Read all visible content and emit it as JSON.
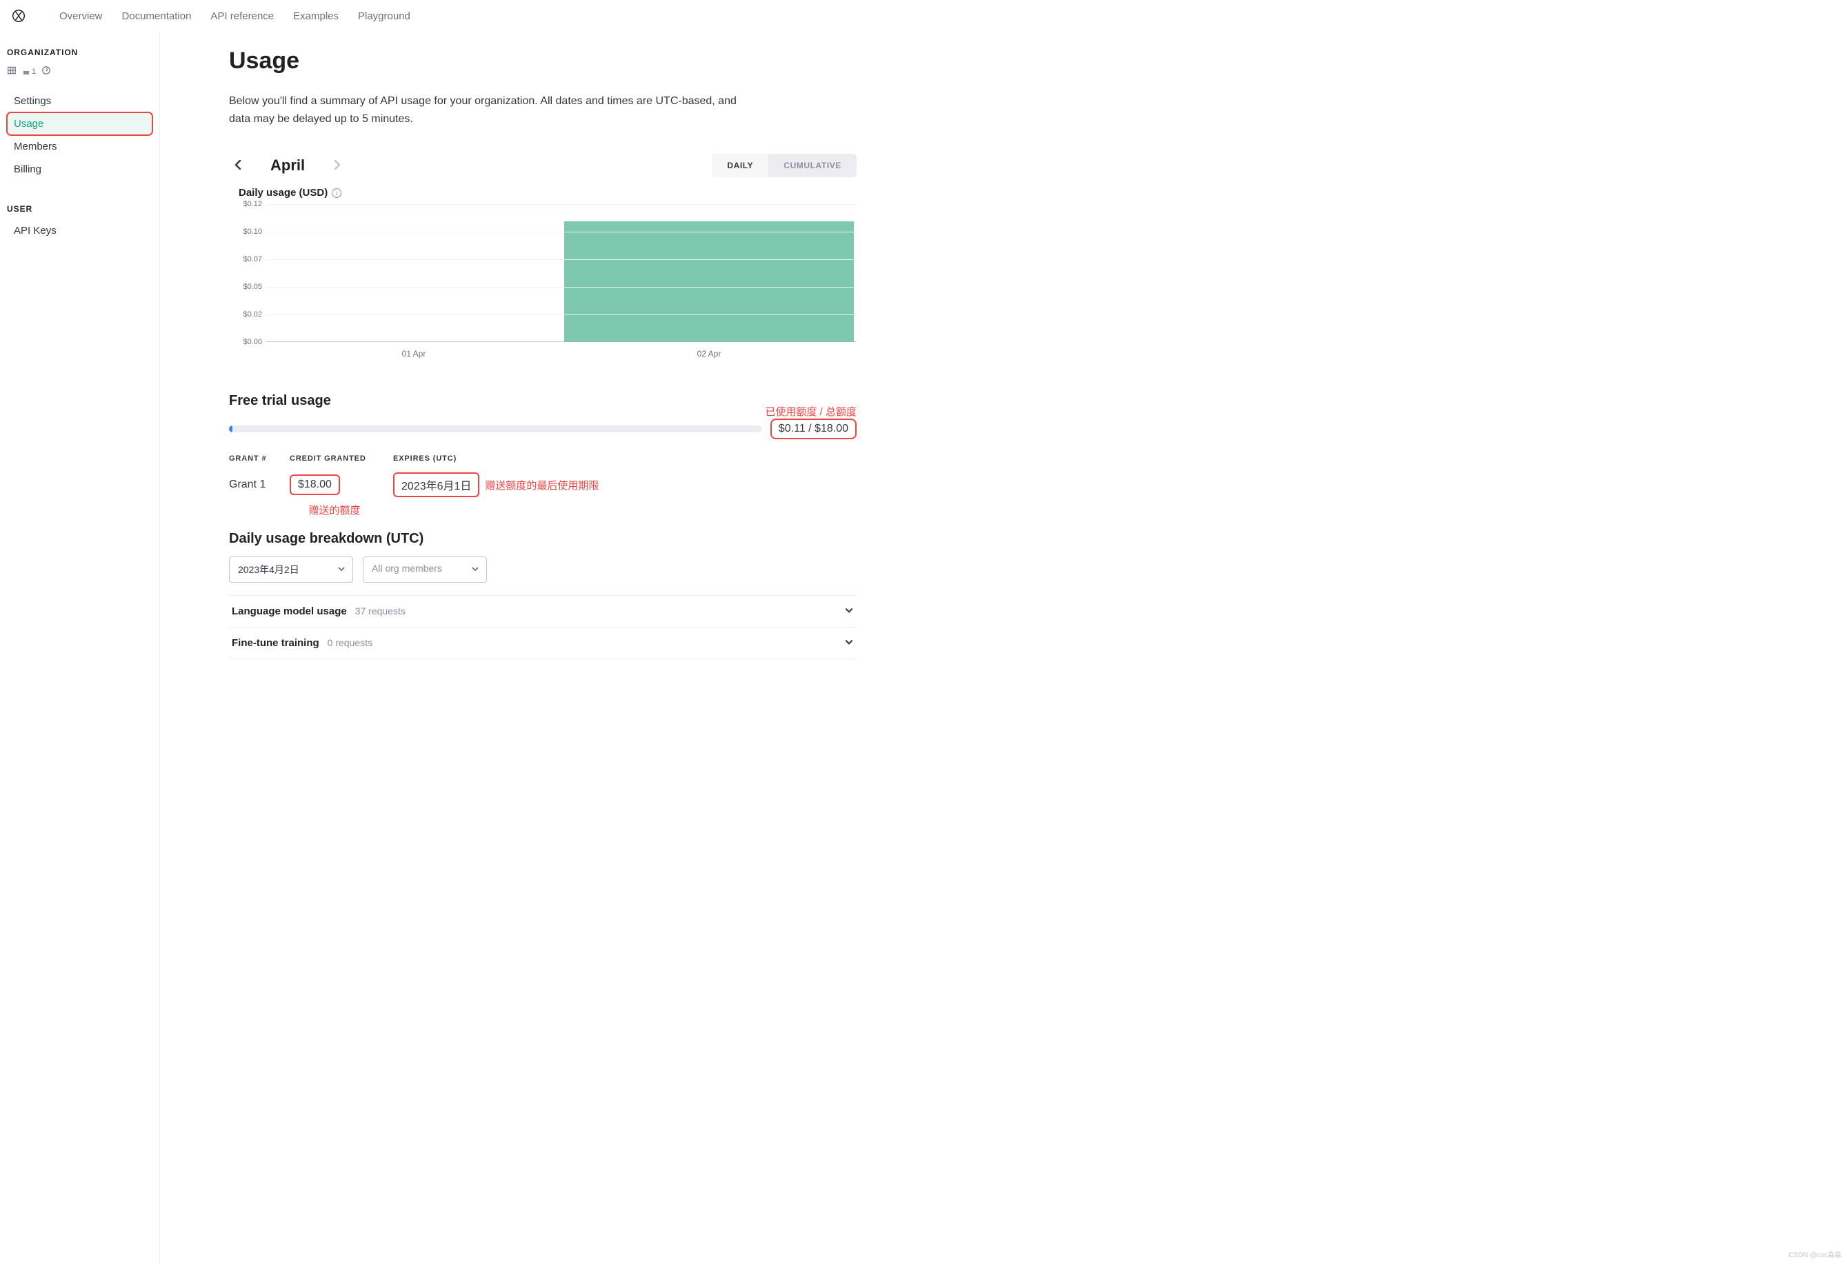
{
  "top_nav": [
    "Overview",
    "Documentation",
    "API reference",
    "Examples",
    "Playground"
  ],
  "sidebar": {
    "org_heading": "ORGANIZATION",
    "user_heading": "USER",
    "org_badge": "1",
    "items": [
      "Settings",
      "Usage",
      "Members",
      "Billing"
    ],
    "user_items": [
      "API Keys"
    ],
    "active_index": 1
  },
  "page": {
    "title": "Usage",
    "subtitle": "Below you'll find a summary of API usage for your organization. All dates and times are UTC-based, and data may be delayed up to 5 minutes.",
    "month": "April",
    "toggle": {
      "daily": "DAILY",
      "cumulative": "CUMULATIVE",
      "active": "daily"
    },
    "chart_title": "Daily usage (USD)"
  },
  "chart_data": {
    "type": "bar",
    "title": "Daily usage (USD)",
    "xlabel": "",
    "ylabel": "",
    "y_ticks": [
      "$0.12",
      "$0.10",
      "$0.07",
      "$0.05",
      "$0.02",
      "$0.00"
    ],
    "ylim": [
      0,
      0.12
    ],
    "categories": [
      "01 Apr",
      "02 Apr"
    ],
    "values": [
      0,
      0.105
    ]
  },
  "free_trial": {
    "heading": "Free trial usage",
    "used": "$0.11",
    "total": "$18.00",
    "ratio_label": "$0.11 / $18.00",
    "progress_pct": 0.6,
    "annotation_ratio": "已使用额度 / 总额度",
    "table": {
      "headers": [
        "GRANT #",
        "CREDIT GRANTED",
        "EXPIRES (UTC)"
      ],
      "row": {
        "grant": "Grant 1",
        "credit": "$18.00",
        "expires": "2023年6月1日"
      }
    },
    "annotation_credit": "赠送的额度",
    "annotation_expires": "赠送额度的最后使用期限"
  },
  "breakdown": {
    "heading": "Daily usage breakdown (UTC)",
    "date_select": "2023年4月2日",
    "member_select_placeholder": "All org members",
    "rows": [
      {
        "title": "Language model usage",
        "sub": "37 requests"
      },
      {
        "title": "Fine-tune training",
        "sub": "0 requests"
      }
    ]
  },
  "watermark": "CSDN @cuc淼淼"
}
